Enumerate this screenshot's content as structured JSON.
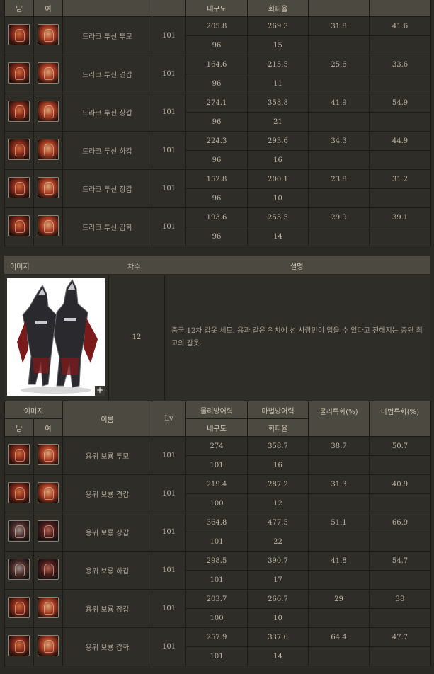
{
  "top_header": {
    "male": "남",
    "female": "여",
    "durability": "내구도",
    "evasion": "회피율"
  },
  "draco_rows": [
    {
      "name": "드라코 투신 투모",
      "lv": "101",
      "d1": "205.8",
      "e1": "269.3",
      "c1": "31.8",
      "c2": "41.6",
      "d2": "96",
      "e2": "15"
    },
    {
      "name": "드라코 투신 견갑",
      "lv": "101",
      "d1": "164.6",
      "e1": "215.5",
      "c1": "25.6",
      "c2": "33.6",
      "d2": "96",
      "e2": "11"
    },
    {
      "name": "드라코 투신 상갑",
      "lv": "101",
      "d1": "274.1",
      "e1": "358.8",
      "c1": "41.9",
      "c2": "54.9",
      "d2": "96",
      "e2": "21"
    },
    {
      "name": "드라코 투신 하갑",
      "lv": "101",
      "d1": "224.3",
      "e1": "293.6",
      "c1": "34.3",
      "c2": "44.9",
      "d2": "96",
      "e2": "16"
    },
    {
      "name": "드라코 투신 장갑",
      "lv": "101",
      "d1": "152.8",
      "e1": "200.1",
      "c1": "23.8",
      "c2": "31.2",
      "d2": "96",
      "e2": "10"
    },
    {
      "name": "드라코 투신 갑화",
      "lv": "101",
      "d1": "193.6",
      "e1": "253.5",
      "c1": "29.9",
      "c2": "39.1",
      "d2": "96",
      "e2": "14"
    }
  ],
  "info": {
    "image_label": "이미지",
    "tier_label": "차수",
    "desc_label": "설명",
    "tier": "12",
    "description": "중국 12차 갑옷 세트. 용과 같은 위치에 선 사람만이 입을 수 있다고 전해지는 중원 최고의 갑옷.",
    "plus": "+"
  },
  "bottom_header": {
    "image": "이미지",
    "male": "남",
    "female": "여",
    "name": "이름",
    "lv": "Lv",
    "phys_def": "물리방어력",
    "mag_def": "마법방어력",
    "phys_crit": "물리특화(%)",
    "mag_crit": "마법특화(%)",
    "durability": "내구도",
    "evasion": "회피율"
  },
  "dragon_rows": [
    {
      "name": "용위 보룡 투모",
      "lv": "101",
      "d1": "274",
      "e1": "358.7",
      "c1": "38.7",
      "c2": "50.7",
      "d2": "101",
      "e2": "16"
    },
    {
      "name": "용위 보룡 견갑",
      "lv": "101",
      "d1": "219.4",
      "e1": "287.2",
      "c1": "31.3",
      "c2": "40.9",
      "d2": "100",
      "e2": "12"
    },
    {
      "name": "용위 보룡 상갑",
      "lv": "101",
      "d1": "364.8",
      "e1": "477.5",
      "c1": "51.1",
      "c2": "66.9",
      "d2": "101",
      "e2": "22"
    },
    {
      "name": "용위 보룡 하갑",
      "lv": "101",
      "d1": "298.5",
      "e1": "390.7",
      "c1": "41.8",
      "c2": "54.7",
      "d2": "101",
      "e2": "17"
    },
    {
      "name": "용위 보룡 장갑",
      "lv": "101",
      "d1": "203.7",
      "e1": "266.7",
      "c1": "29",
      "c2": "38",
      "d2": "100",
      "e2": "10"
    },
    {
      "name": "용위 보룡 갑화",
      "lv": "101",
      "d1": "257.9",
      "e1": "337.6",
      "c1": "64.4",
      "c2": "47.7",
      "d2": "101",
      "e2": "14"
    }
  ],
  "icons": {
    "male": "armor-piece-male-icon",
    "female": "armor-piece-female-icon"
  }
}
